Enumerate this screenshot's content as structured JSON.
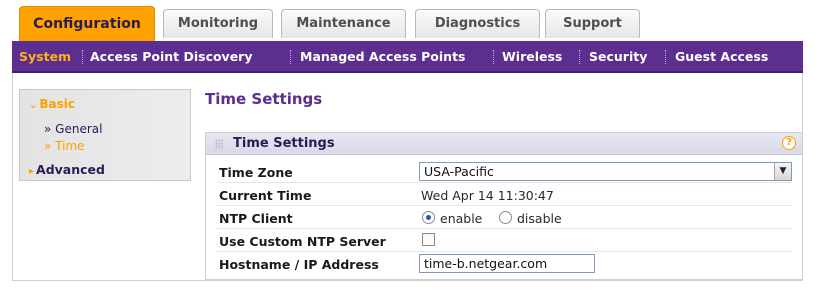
{
  "tabs": [
    {
      "label": "Configuration",
      "active": true
    },
    {
      "label": "Monitoring"
    },
    {
      "label": "Maintenance"
    },
    {
      "label": "Diagnostics"
    },
    {
      "label": "Support"
    }
  ],
  "subnav": [
    {
      "label": "System",
      "active": true
    },
    {
      "label": "Access Point Discovery"
    },
    {
      "label": "Managed Access Points"
    },
    {
      "label": "Wireless"
    },
    {
      "label": "Security"
    },
    {
      "label": "Guest Access"
    }
  ],
  "sidebar": {
    "basic_label": "Basic",
    "items": [
      {
        "label": "General"
      },
      {
        "label": "Time",
        "active": true
      }
    ],
    "advanced_label": "Advanced"
  },
  "main": {
    "page_title": "Time Settings",
    "panel_title": "Time Settings",
    "help_symbol": "?",
    "fields": {
      "time_zone": {
        "label": "Time Zone",
        "value": "USA-Pacific"
      },
      "current_time": {
        "label": "Current Time",
        "value": "Wed Apr 14 11:30:47"
      },
      "ntp_client": {
        "label": "NTP Client",
        "option_enable": "enable",
        "option_disable": "disable",
        "selected": "enable"
      },
      "custom_ntp": {
        "label": "Use Custom NTP Server",
        "checked": false
      },
      "hostname": {
        "label": "Hostname / IP Address",
        "value": "time-b.netgear.com"
      }
    }
  },
  "colors": {
    "accent_orange": "#ffa200",
    "nav_purple": "#5b2e8f",
    "title_purple": "#5b2e8f"
  }
}
